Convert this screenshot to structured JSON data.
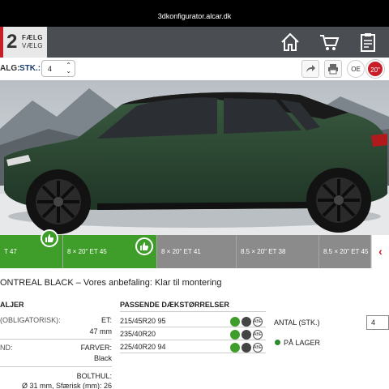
{
  "browser": {
    "url": "3dkonfigurator.alcar.dk"
  },
  "header": {
    "step_number": "2",
    "step_line1": "FÆLG",
    "step_line2": "VÆLG",
    "icons": [
      "home-icon",
      "cart-icon",
      "clipboard-icon"
    ]
  },
  "toolbar": {
    "label": "ALG:",
    "stk_label": "STK.:",
    "quantity": "4",
    "oe_label": "OE",
    "size_label": "20\"",
    "accent": "#c81e28"
  },
  "rims": [
    {
      "label": "T 47",
      "state": "green"
    },
    {
      "label": "8 × 20\" ET 45",
      "state": "green"
    },
    {
      "label": "8 × 20\" ET 41",
      "state": "grey"
    },
    {
      "label": "8.5 × 20\" ET 38",
      "state": "grey"
    },
    {
      "label": "8.5 × 20\" ET 45",
      "state": "grey"
    }
  ],
  "product": {
    "title": "ONTREAL BLACK – Vores anbefaling: Klar til montering"
  },
  "details": {
    "title": "ALJER",
    "et_label_left": "(OBLIGATORISK):",
    "et_label": "ET:",
    "et_value": "47 mm",
    "brand_label": "ND:",
    "color_label": "FARVER:",
    "color_value": "Black",
    "bolt_label": "BOLTHUL:",
    "bolt_value": "Ø 31 mm, Sfærisk (mm): 26"
  },
  "tyres": {
    "title": "PASSENDE DÆKSTØRRELSER",
    "items": [
      "215/45R20 95",
      "235/40R20",
      "225/40R20 94"
    ],
    "badge": "ABE"
  },
  "order": {
    "antal_label": "ANTAL (STK.)",
    "antal_value": "4",
    "stock_label": "PÅ LAGER",
    "stock_color": "#2e8a2a"
  }
}
